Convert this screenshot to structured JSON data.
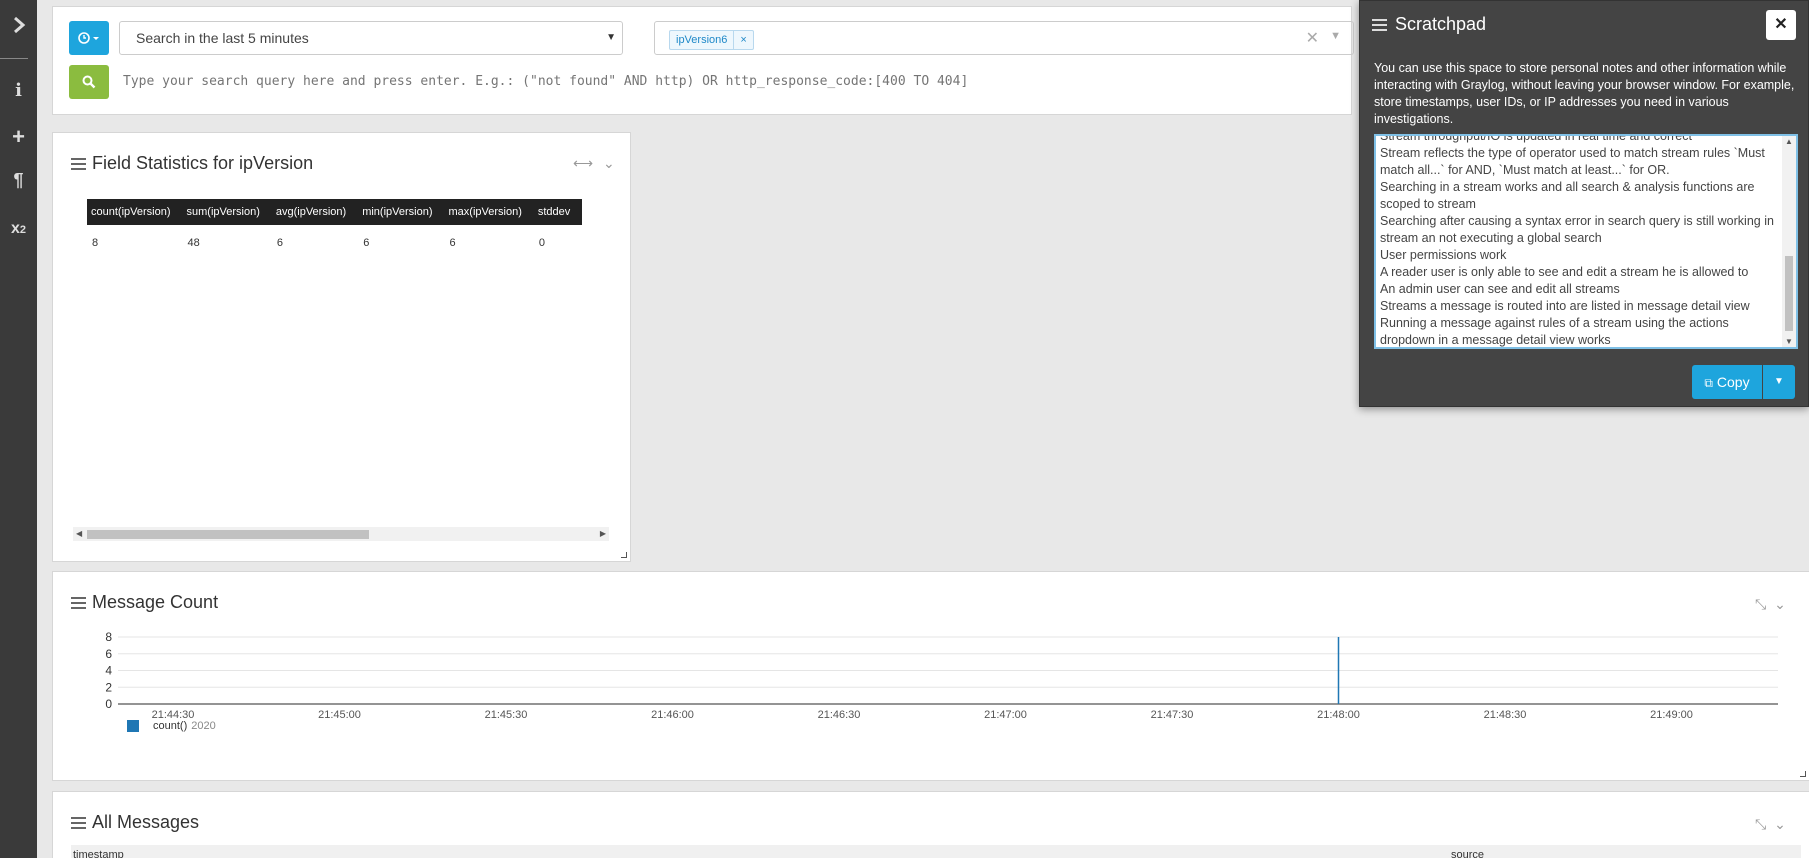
{
  "nav": {
    "icons": [
      "chevron-right-icon",
      "info-icon",
      "plus-icon",
      "paragraph-icon",
      "subscript-icon"
    ]
  },
  "search": {
    "range_label": "Search in the last 5 minutes",
    "stream_tag": "ipVersion6",
    "stream_tag_remove": "×",
    "stream_clear": "✕",
    "query_placeholder": "Type your search query here and press enter. E.g.: (\"not found\" AND http) OR http_response_code:[400 TO 404]"
  },
  "field_stats": {
    "title": "Field Statistics for ipVersion",
    "columns": [
      "count(ipVersion)",
      "sum(ipVersion)",
      "avg(ipVersion)",
      "min(ipVersion)",
      "max(ipVersion)",
      "stddev"
    ],
    "row": [
      "8",
      "48",
      "6",
      "6",
      "6",
      "0"
    ]
  },
  "message_count": {
    "title": "Message Count",
    "legend_label": "count()",
    "legend_suffix": "2020"
  },
  "chart_data": {
    "type": "bar",
    "title": "Message Count",
    "x_ticks": [
      "21:44:30",
      "21:45:00",
      "21:45:30",
      "21:46:00",
      "21:46:30",
      "21:47:00",
      "21:47:30",
      "21:48:00",
      "21:48:30",
      "21:49:00"
    ],
    "y_ticks": [
      0,
      2,
      4,
      6,
      8
    ],
    "ylim": [
      0,
      8
    ],
    "series": [
      {
        "name": "count()",
        "x": [
          "21:48:00"
        ],
        "values": [
          8
        ]
      }
    ],
    "grid": true,
    "legend": "bottom-left",
    "color": "#1f77b4"
  },
  "all_messages": {
    "title": "All Messages",
    "col_timestamp": "timestamp",
    "col_source": "source"
  },
  "scratchpad": {
    "title": "Scratchpad",
    "close": "✕",
    "description": "You can use this space to store personal notes and other information while interacting with Graylog, without leaving your browser window. For example, store timestamps, user IDs, or IP addresses you need in various investigations.",
    "lines": [
      " Stream throughput/IO is updated in real time and correct",
      " Stream reflects the type of operator used to match stream rules `Must match all...` for AND, `Must match at least...` for OR.",
      " Searching in a stream works and all search & analysis functions are scoped to stream",
      " Searching after causing a syntax error in search query is still working in stream an not executing a global search",
      " User permissions work",
      " A reader user is only able to see and edit a stream he is allowed to",
      " An admin user can see and edit all streams",
      " Streams a message is routed into are listed in message detail view",
      " Running a message against rules of a stream using the actions dropdown in a message detail view works"
    ],
    "copy_label": "Copy"
  },
  "colors": {
    "primary": "#1ea5dd",
    "success": "#8bbc3f",
    "nav_bg": "#3a3a3a",
    "scratch_bg": "#444444"
  }
}
